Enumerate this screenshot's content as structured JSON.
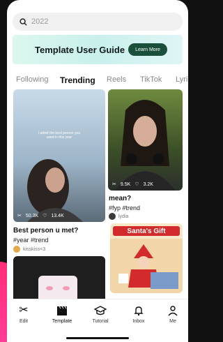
{
  "search": {
    "placeholder": "2022"
  },
  "banner": {
    "title": "Template User Guide",
    "button": "Learn More"
  },
  "tabs": [
    "Following",
    "Trending",
    "Reels",
    "TikTok",
    "Lyrics"
  ],
  "cards": [
    {
      "overlay": "i admit the best person you used in this year",
      "likes": "50.3K",
      "hearts": "13.4K",
      "title": "Best person u met?",
      "tags": "#year #trend",
      "author": "kisskiss<3"
    },
    {
      "likes": "9.5K",
      "hearts": "3.2K",
      "title": "mean?",
      "tags": "#fyp #trend",
      "author": "lydia"
    },
    {
      "badge": "Santa's Gift"
    }
  ],
  "nav": [
    "Edit",
    "Template",
    "Tutorial",
    "Inbox",
    "Me"
  ],
  "colors": {
    "accent": "#1a4f3b",
    "brand": "#ff2d78"
  }
}
